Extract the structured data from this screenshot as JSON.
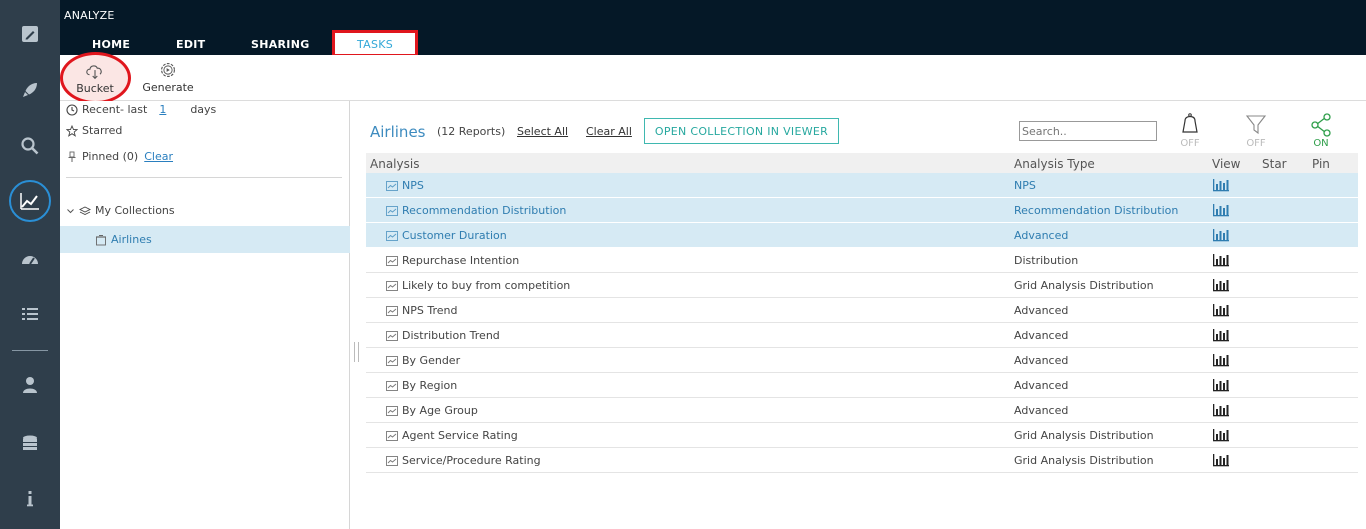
{
  "app": {
    "title": "ANALYZE"
  },
  "tabs": [
    {
      "label": "HOME"
    },
    {
      "label": "EDIT"
    },
    {
      "label": "SHARING"
    },
    {
      "label": "TASKS"
    }
  ],
  "toolbar": {
    "bucket_label": "Bucket",
    "generate_label": "Generate"
  },
  "rail_icons": [
    "edit-icon",
    "rocket-icon",
    "search-icon",
    "analyze-chart-icon",
    "dashboard-icon",
    "list-icon",
    "user-icon",
    "database-icon",
    "info-icon"
  ],
  "left_panel": {
    "recent_prefix": "Recent- last",
    "recent_days_value": "1",
    "recent_suffix": "days",
    "starred_label": "Starred",
    "pinned_label": "Pinned (0)",
    "clear_label": "Clear",
    "my_collections_label": "My Collections",
    "collection_item": "Airlines"
  },
  "main": {
    "collection_title": "Airlines",
    "report_count": "(12 Reports)",
    "select_all": "Select All",
    "clear_all": "Clear All",
    "open_button": "OPEN COLLECTION IN VIEWER",
    "search_placeholder": "Search..",
    "toggles": [
      {
        "icon": "bell-icon",
        "label": "OFF"
      },
      {
        "icon": "filter-icon",
        "label": "OFF"
      },
      {
        "icon": "share-icon",
        "label": "ON"
      }
    ],
    "columns": {
      "analysis": "Analysis",
      "type": "Analysis Type",
      "view": "View",
      "star": "Star",
      "pin": "Pin"
    },
    "rows": [
      {
        "name": "NPS",
        "type": "NPS",
        "selected": true
      },
      {
        "name": "Recommendation Distribution",
        "type": "Recommendation Distribution",
        "selected": true
      },
      {
        "name": "Customer Duration",
        "type": "Advanced",
        "selected": true
      },
      {
        "name": "Repurchase Intention",
        "type": "Distribution",
        "selected": false
      },
      {
        "name": "Likely to buy from competition",
        "type": "Grid Analysis Distribution",
        "selected": false
      },
      {
        "name": "NPS Trend",
        "type": "Advanced",
        "selected": false
      },
      {
        "name": "Distribution Trend",
        "type": "Advanced",
        "selected": false
      },
      {
        "name": "By Gender",
        "type": "Advanced",
        "selected": false
      },
      {
        "name": "By Region",
        "type": "Advanced",
        "selected": false
      },
      {
        "name": "By Age Group",
        "type": "Advanced",
        "selected": false
      },
      {
        "name": "Agent Service Rating",
        "type": "Grid Analysis Distribution",
        "selected": false
      },
      {
        "name": "Service/Procedure Rating",
        "type": "Grid Analysis Distribution",
        "selected": false
      }
    ]
  },
  "colors": {
    "rail": "#2f3e4b",
    "header": "#051827",
    "accent": "#3d8bbf",
    "highlight": "#e0161d",
    "selected_row": "#d6eaf4",
    "on_green": "#2e9e4a"
  }
}
